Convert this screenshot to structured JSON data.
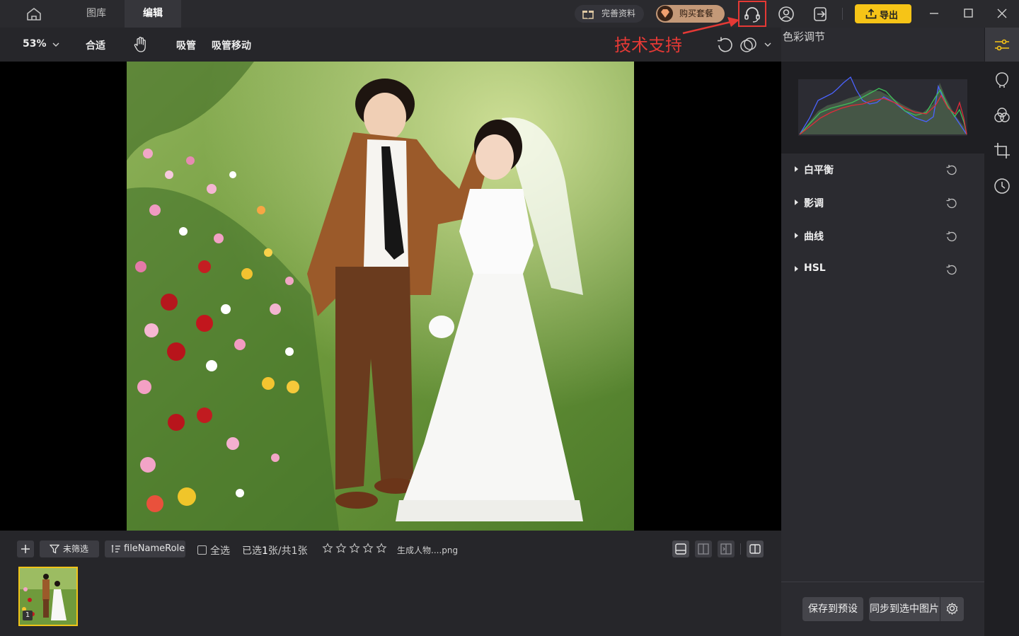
{
  "app": {
    "nav_tabs": [
      {
        "label": "图库",
        "active": false
      },
      {
        "label": "编辑",
        "active": true
      }
    ],
    "gift_label": "完善资料",
    "buy_label": "购买套餐",
    "export_label": "导出",
    "support_annotation": "技术支持"
  },
  "toolbar": {
    "zoom_value": "53%",
    "fit_label": "合适",
    "eyedropper_label": "吸管",
    "eyedropper_move_label": "吸管移动"
  },
  "panel": {
    "title": "色彩调节",
    "sections": [
      {
        "label": "白平衡"
      },
      {
        "label": "影调"
      },
      {
        "label": "曲线"
      },
      {
        "label": "HSL"
      }
    ],
    "save_preset_label": "保存到预设",
    "sync_label": "同步到选中图片"
  },
  "filmstrip": {
    "filter_label": "未筛选",
    "sort_label": "fileNameRole",
    "select_all_label": "全选",
    "selected_prefix": "已选",
    "selected_count": "1",
    "selected_mid": "张/共",
    "total_count": "1",
    "selected_suffix": "张",
    "rating_stars": 0,
    "file_name": "生成人物....png",
    "thumb_index": "1"
  },
  "colors": {
    "accent_yellow": "#f6c417",
    "annotation_red": "#e53935",
    "buy_pill": "#c49978"
  }
}
